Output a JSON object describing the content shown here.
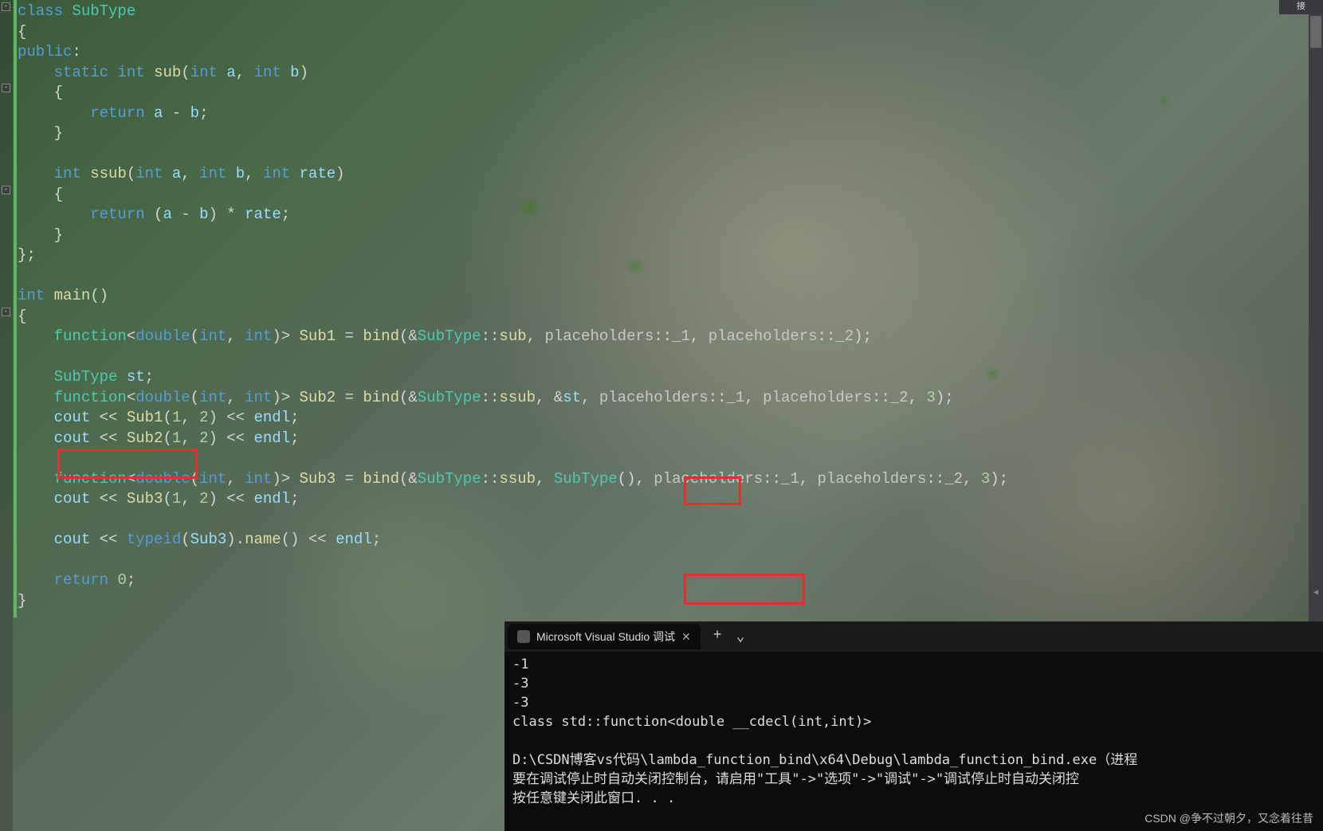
{
  "code": {
    "line1_class": "class",
    "line1_type": "SubType",
    "line2": "{",
    "line3_public": "public",
    "line3_colon": ":",
    "line4_static": "static",
    "line4_int": "int",
    "line4_sub": "sub",
    "line4_params_int1": "int",
    "line4_params_a": "a",
    "line4_params_int2": "int",
    "line4_params_b": "b",
    "line5": "    {",
    "line6_return": "return",
    "line6_expr_a": "a",
    "line6_expr_minus": " - ",
    "line6_expr_b": "b",
    "line7": "    }",
    "line9_int": "int",
    "line9_ssub": "ssub",
    "line9_int1": "int",
    "line9_a": "a",
    "line9_int2": "int",
    "line9_b": "b",
    "line9_int3": "int",
    "line9_rate": "rate",
    "line10": "    {",
    "line11_return": "return",
    "line11_a": "a",
    "line11_minus": " - ",
    "line11_b": "b",
    "line11_mult": " * ",
    "line11_rate": "rate",
    "line12": "    }",
    "line13": "};",
    "line15_int": "int",
    "line15_main": "main",
    "line16": "{",
    "line17_function": "function",
    "line17_double": "double",
    "line17_int1": "int",
    "line17_int2": "int",
    "line17_sub1": "Sub1",
    "line17_bind": "bind",
    "line17_subtype": "SubType",
    "line17_sub": "sub",
    "line17_ph1": "placeholders",
    "line17_ph1v": "_1",
    "line17_ph2": "placeholders",
    "line17_ph2v": "_2",
    "line19_type": "SubType",
    "line19_st": "st",
    "line20_function": "function",
    "line20_double": "double",
    "line20_int1": "int",
    "line20_int2": "int",
    "line20_sub2": "Sub2",
    "line20_bind": "bind",
    "line20_subtype": "SubType",
    "line20_ssub": "ssub",
    "line20_amp": "&",
    "line20_st": "st",
    "line20_ph1": "placeholders",
    "line20_p1": "_1",
    "line20_ph2": "placeholders",
    "line20_p2": "_2",
    "line20_three": "3",
    "line21_cout": "cout",
    "line21_sub1": "Sub1",
    "line21_n1": "1",
    "line21_n2": "2",
    "line21_endl": "endl",
    "line22_cout": "cout",
    "line22_sub2": "Sub2",
    "line22_n1": "1",
    "line22_n2": "2",
    "line22_endl": "endl",
    "line24_function": "function",
    "line24_double": "double",
    "line24_int1": "int",
    "line24_int2": "int",
    "line24_sub3": "Sub3",
    "line24_bind": "bind",
    "line24_subtype1": "SubType",
    "line24_ssub": "ssub",
    "line24_subtype2": "SubType",
    "line24_ph1": "placeholders",
    "line24_p1": "_1",
    "line24_ph2": "placeholders",
    "line24_p2": "_2",
    "line24_three": "3",
    "line25_cout": "cout",
    "line25_sub3": "Sub3",
    "line25_n1": "1",
    "line25_n2": "2",
    "line25_endl": "endl",
    "line27_cout": "cout",
    "line27_typeid": "typeid",
    "line27_sub3": "Sub3",
    "line27_name": "name",
    "line27_endl": "endl",
    "line29_return": "return",
    "line29_zero": "0",
    "line30": "}"
  },
  "terminal": {
    "tab_title": "Microsoft Visual Studio 调试",
    "out1": "-1",
    "out2": "-3",
    "out3": "-3",
    "out4": "class std::function<double __cdecl(int,int)>",
    "out5": "D:\\CSDN博客vs代码\\lambda_function_bind\\x64\\Debug\\lambda_function_bind.exe（进程 ",
    "out6": "要在调试停止时自动关闭控制台，请启用\"工具\"->\"选项\"->\"调试\"->\"调试停止时自动关闭控",
    "out7": "按任意键关闭此窗口. . ."
  },
  "ui": {
    "minimap_label": "接",
    "watermark": "CSDN @争不过朝夕，又念着往昔"
  }
}
